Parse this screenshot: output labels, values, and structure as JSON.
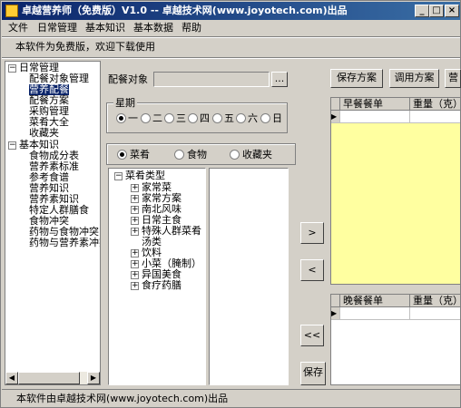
{
  "window": {
    "title": "卓越营养师（免费版）V1.0 -- 卓越技术网(www.joyotech.com)出品",
    "minimize": "_",
    "maximize": "□",
    "close": "×"
  },
  "menu": [
    "文件",
    "日常管理",
    "基本知识",
    "基本数据",
    "帮助"
  ],
  "notice": "本软件为免费版，欢迎下载使用",
  "tree": {
    "root1": "日常管理",
    "root1_items": [
      "配餐对象管理",
      "营养配餐",
      "配餐方案",
      "采购管理",
      "菜肴大全",
      "收藏夹"
    ],
    "root2": "基本知识",
    "root2_items": [
      "食物成分表",
      "营养素标准",
      "参考食谱",
      "营养知识",
      "营养素知识",
      "特定人群膳食",
      "食物冲突",
      "药物与食物冲突",
      "药物与营养素冲突"
    ]
  },
  "target": {
    "label": "配餐对象",
    "value": "",
    "browse": "..."
  },
  "week": {
    "label": "星期",
    "days": [
      "一",
      "二",
      "三",
      "四",
      "五",
      "六",
      "日"
    ],
    "selected": "一"
  },
  "category": {
    "options": [
      "菜肴",
      "食物",
      "收藏夹"
    ],
    "selected": "菜肴"
  },
  "dish_tree": {
    "root": "菜肴类型",
    "items": [
      "家常菜",
      "家常方案",
      "南北风味",
      "日常主食",
      "特殊人群菜肴",
      "汤类",
      "饮料",
      "小菜（腌制）",
      "异国美食",
      "食疗药膳"
    ]
  },
  "buttons": {
    "add": ">",
    "remove": "<",
    "remove_all": "<<",
    "save_plan": "保存方案",
    "load_plan": "调用方案",
    "third": "营",
    "save": "保存"
  },
  "breakfast": {
    "col1": "早餐餐单",
    "col2": "重量（克）"
  },
  "dinner": {
    "col1": "晚餐餐单",
    "col2": "重量（克）"
  },
  "status": "本软件由卓越技术网(www.joyotech.com)出品",
  "colors": {
    "titlebar": "#0a246a",
    "grid_bg": "#ffffa0",
    "face": "#d4d0c8"
  }
}
